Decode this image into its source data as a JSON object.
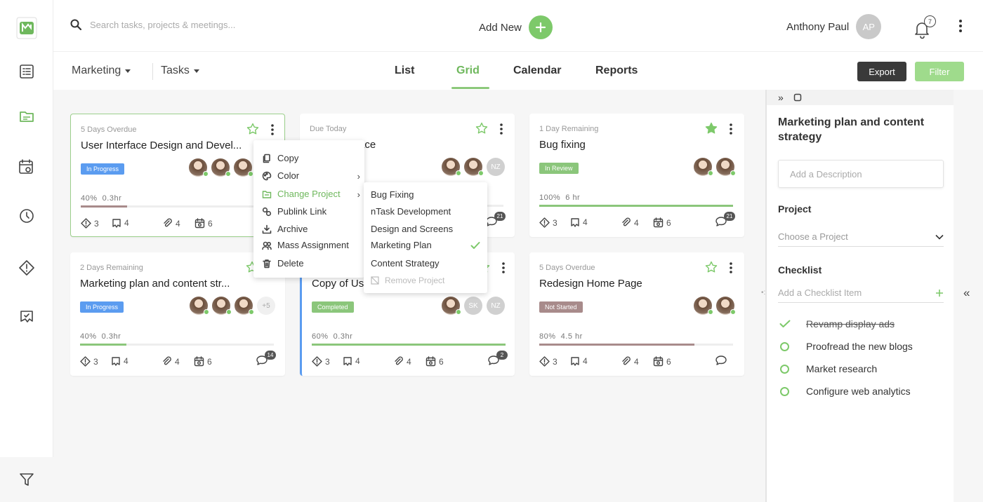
{
  "search": {
    "placeholder": "Search tasks, projects & meetings..."
  },
  "header": {
    "add_new_label": "Add New",
    "user_name": "Anthony Paul",
    "user_initials": "AP",
    "notification_count": "7"
  },
  "subheader": {
    "project_dropdown": "Marketing",
    "type_dropdown": "Tasks",
    "tabs": [
      "List",
      "Grid",
      "Calendar",
      "Reports"
    ],
    "active_tab": "Grid",
    "export_label": "Export",
    "filter_label": "Filter"
  },
  "sidebar": {
    "items": [
      "logo-icon",
      "tasks-icon",
      "projects-icon",
      "calendar-icon",
      "timesheet-icon",
      "issues-icon",
      "risks-icon",
      "filter-icon"
    ]
  },
  "cards": [
    {
      "status": "5 Days Overdue",
      "title": "User Interface Design and Devel...",
      "badge": "In Progress",
      "badge_color": "#5b9cf0",
      "progress_pct": "40%",
      "progress_time": "0.3hr",
      "progress": 0.4,
      "bar_color": "#a88b8b",
      "starred": false,
      "issues": "3",
      "risks": "4",
      "attachments": "4",
      "meetings": "6",
      "comments": "",
      "extra_members": ""
    },
    {
      "status": "Due Today",
      "title": "User Interface",
      "badge": "",
      "badge_color": "#5b9cf0",
      "progress_pct": "",
      "progress_time": "",
      "progress": 0,
      "bar_color": "#8bc67b",
      "starred": false,
      "issues": "3",
      "risks": "4",
      "attachments": "4",
      "meetings": "6",
      "comments": "21",
      "extra_members": "",
      "member_initials": "NZ"
    },
    {
      "status": "1 Day Remaining",
      "title": "Bug fixing",
      "badge": "In Review",
      "badge_color": "#8bc67b",
      "progress_pct": "100%",
      "progress_time": "6 hr",
      "progress": 1.0,
      "bar_color": "#8bc67b",
      "starred": true,
      "issues": "3",
      "risks": "4",
      "attachments": "4",
      "meetings": "6",
      "comments": "21",
      "extra_members": ""
    },
    {
      "status": "2 Days Remaining",
      "title": "Marketing plan and content str...",
      "badge": "In Progress",
      "badge_color": "#5b9cf0",
      "progress_pct": "40%",
      "progress_time": "0.3hr",
      "progress": 0.4,
      "bar_color": "#8bc67b",
      "starred": false,
      "issues": "3",
      "risks": "4",
      "attachments": "4",
      "meetings": "6",
      "comments": "14",
      "extra_members": "+5"
    },
    {
      "status": "",
      "title": "Copy of User Interface",
      "badge": "Completed",
      "badge_color": "#8bc67b",
      "progress_pct": "60%",
      "progress_time": "0.3hr",
      "progress": 1.0,
      "bar_color": "#8bc67b",
      "starred": false,
      "issues": "3",
      "risks": "4",
      "attachments": "4",
      "meetings": "6",
      "comments": "2",
      "extra_members": "",
      "member_initials_1": "SK",
      "member_initials_2": "NZ"
    },
    {
      "status": "5 Days Overdue",
      "title": "Redesign Home Page",
      "badge": "Not Started",
      "badge_color": "#a88b8b",
      "progress_pct": "80%",
      "progress_time": "4.5 hr",
      "progress": 0.8,
      "bar_color": "#a88b8b",
      "starred": false,
      "issues": "3",
      "risks": "4",
      "attachments": "4",
      "meetings": "6",
      "comments": "",
      "extra_members": ""
    }
  ],
  "context_menu": {
    "items": [
      {
        "label": "Copy",
        "icon": "copy-icon"
      },
      {
        "label": "Color",
        "icon": "palette-icon"
      },
      {
        "label": "Change Project",
        "icon": "folder-icon"
      },
      {
        "label": "Publink Link",
        "icon": "link-icon"
      },
      {
        "label": "Archive",
        "icon": "archive-icon"
      },
      {
        "label": "Mass Assignment",
        "icon": "users-icon"
      },
      {
        "label": "Delete",
        "icon": "trash-icon"
      }
    ]
  },
  "project_submenu": {
    "items": [
      "Bug Fixing",
      "nTask Development",
      "Design and Screens",
      "Marketing Plan",
      "Content Strategy"
    ],
    "selected": "Marketing Plan",
    "remove_label": "Remove Project"
  },
  "detail_panel": {
    "title": "Marketing plan and content strategy",
    "description_placeholder": "Add a Description",
    "project_label": "Project",
    "project_placeholder": "Choose a Project",
    "checklist_label": "Checklist",
    "checklist_placeholder": "Add a Checklist Item",
    "checklist": [
      {
        "text": "Revamp display ads",
        "done": true
      },
      {
        "text": "Proofread the new blogs",
        "done": false
      },
      {
        "text": "Market research",
        "done": false
      },
      {
        "text": "Configure web analytics",
        "done": false
      }
    ]
  },
  "colors": {
    "accent": "#7dc96a",
    "in_progress": "#5b9cf0",
    "not_started": "#a88b8b",
    "dark_button": "#3a3a3a"
  }
}
